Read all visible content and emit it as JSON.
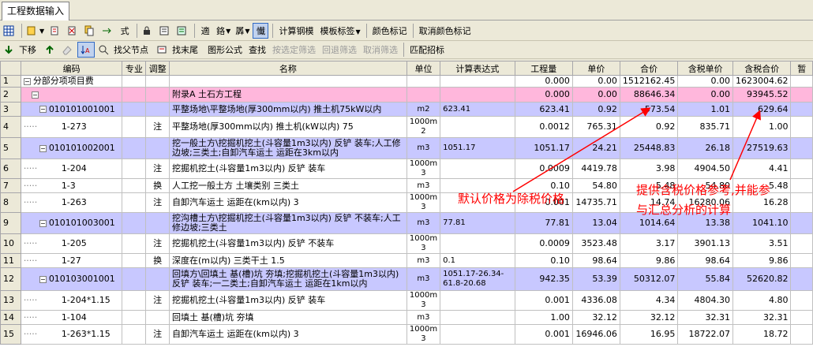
{
  "tab_title": "工程数据输入",
  "toolbar1": {
    "calc_steel": "计算钢模",
    "template_label": "模板标签",
    "color_mark": "颜色标记",
    "cancel_color_mark": "取消颜色标记",
    "icon_labels": {
      "i1": "",
      "i6": "式",
      "i7": "",
      "i12": "適",
      "i13": "鉻",
      "i14": "羼",
      "i15": "懴"
    }
  },
  "toolbar2": {
    "move_down": "下移",
    "find_parent": "找父节点",
    "find_tail": "找末尾",
    "shape_formula": "图形公式",
    "search": "查找",
    "select_filter": "按选定筛选",
    "restore_filter": "回退筛选",
    "cancel_filter": "取消筛选",
    "match_bid": "匹配招标"
  },
  "columns": [
    "编码",
    "专业",
    "调整",
    "名称",
    "单位",
    "计算表达式",
    "工程量",
    "单价",
    "合价",
    "含税单价",
    "含税合价",
    "暂"
  ],
  "rows": [
    {
      "n": "1",
      "code": "分部分项项目费",
      "pro": "",
      "adj": "",
      "name": "",
      "unit": "",
      "expr": "",
      "qty": "0.000",
      "price": "0.00",
      "total": "1512162.45",
      "tax_price": "0.00",
      "tax_total": "1623004.62",
      "style": ""
    },
    {
      "n": "2",
      "code": "",
      "pro": "",
      "adj": "",
      "name": "附录A 土石方工程",
      "unit": "",
      "expr": "",
      "qty": "0.000",
      "price": "0.00",
      "total": "88646.34",
      "tax_price": "0.00",
      "tax_total": "93945.52",
      "style": "pink"
    },
    {
      "n": "3",
      "code": "010101001001",
      "pro": "",
      "adj": "",
      "name": "平整场地\\平整场地(厚300mm以内) 推土机75kW以内",
      "unit": "m2",
      "expr": "623.41",
      "qty": "623.41",
      "price": "0.92",
      "total": "573.54",
      "tax_price": "1.01",
      "tax_total": "629.64",
      "style": "lav"
    },
    {
      "n": "4",
      "code": "1-273",
      "pro": "",
      "adj": "注",
      "name": "平整场地(厚300mm以内) 推土机(kW以内) 75",
      "unit": "1000m 2",
      "expr": "",
      "qty": "0.0012",
      "price": "765.31",
      "total": "0.92",
      "tax_price": "835.71",
      "tax_total": "1.00",
      "style": ""
    },
    {
      "n": "5",
      "code": "010101002001",
      "pro": "",
      "adj": "",
      "name": "挖一般土方\\挖掘机挖土(斗容量1m3以内) 反铲 装车;人工修边坡;三类土;自卸汽车运土 运距在3km以内",
      "unit": "m3",
      "expr": "1051.17",
      "qty": "1051.17",
      "price": "24.21",
      "total": "25448.83",
      "tax_price": "26.18",
      "tax_total": "27519.63",
      "style": "lav"
    },
    {
      "n": "6",
      "code": "1-204",
      "pro": "",
      "adj": "注",
      "name": "挖掘机挖土(斗容量1m3以内) 反铲 装车",
      "unit": "1000m 3",
      "expr": "",
      "qty": "0.0009",
      "price": "4419.78",
      "total": "3.98",
      "tax_price": "4904.50",
      "tax_total": "4.41",
      "style": ""
    },
    {
      "n": "7",
      "code": "1-3",
      "pro": "",
      "adj": "换",
      "name": "人工挖一般土方 土壤类别 三类土",
      "unit": "m3",
      "expr": "",
      "qty": "0.10",
      "price": "54.80",
      "total": "5.48",
      "tax_price": "54.80",
      "tax_total": "5.48",
      "style": ""
    },
    {
      "n": "8",
      "code": "1-263",
      "pro": "",
      "adj": "注",
      "name": "自卸汽车运土 运距在(km以内) 3",
      "unit": "1000m 3",
      "expr": "",
      "qty": "0.001",
      "price": "14735.71",
      "total": "14.74",
      "tax_price": "16280.06",
      "tax_total": "16.28",
      "style": ""
    },
    {
      "n": "9",
      "code": "010101003001",
      "pro": "",
      "adj": "",
      "name": "挖沟槽土方\\挖掘机挖土(斗容量1m3以内) 反铲 不装车;人工修边坡;三类土",
      "unit": "m3",
      "expr": "77.81",
      "qty": "77.81",
      "price": "13.04",
      "total": "1014.64",
      "tax_price": "13.38",
      "tax_total": "1041.10",
      "style": "lav"
    },
    {
      "n": "10",
      "code": "1-205",
      "pro": "",
      "adj": "注",
      "name": "挖掘机挖土(斗容量1m3以内) 反铲 不装车",
      "unit": "1000m 3",
      "expr": "",
      "qty": "0.0009",
      "price": "3523.48",
      "total": "3.17",
      "tax_price": "3901.13",
      "tax_total": "3.51",
      "style": ""
    },
    {
      "n": "11",
      "code": "1-27",
      "pro": "",
      "adj": "换",
      "name": "深度在(m以内) 三类干土 1.5",
      "unit": "m3",
      "expr": "0.1",
      "qty": "0.10",
      "price": "98.64",
      "total": "9.86",
      "tax_price": "98.64",
      "tax_total": "9.86",
      "style": ""
    },
    {
      "n": "12",
      "code": "010103001001",
      "pro": "",
      "adj": "",
      "name": "回填方\\回填土 基(槽)坑 夯填;挖掘机挖土(斗容量1m3以内) 反铲 装车;一二类土;自卸汽车运土 运距在1km以内",
      "unit": "m3",
      "expr": "1051.17-26.34-61.8-20.68",
      "qty": "942.35",
      "price": "53.39",
      "total": "50312.07",
      "tax_price": "55.84",
      "tax_total": "52620.82",
      "style": "lav"
    },
    {
      "n": "13",
      "code": "1-204*1.15",
      "pro": "",
      "adj": "注",
      "name": "挖掘机挖土(斗容量1m3以内) 反铲 装车",
      "unit": "1000m 3",
      "expr": "",
      "qty": "0.001",
      "price": "4336.08",
      "total": "4.34",
      "tax_price": "4804.30",
      "tax_total": "4.80",
      "style": ""
    },
    {
      "n": "14",
      "code": "1-104",
      "pro": "",
      "adj": "",
      "name": "回填土 基(槽)坑 夯填",
      "unit": "m3",
      "expr": "",
      "qty": "1.00",
      "price": "32.12",
      "total": "32.12",
      "tax_price": "32.31",
      "tax_total": "32.31",
      "style": ""
    },
    {
      "n": "15",
      "code": "1-263*1.15",
      "pro": "",
      "adj": "注",
      "name": "自卸汽车运土 运距在(km以内) 3",
      "unit": "1000m 3",
      "expr": "",
      "qty": "0.001",
      "price": "16946.06",
      "total": "16.95",
      "tax_price": "18722.07",
      "tax_total": "18.72",
      "style": ""
    }
  ],
  "annotations": {
    "left": "默认价格为除税价格",
    "right_line1": "提供含税价格参考,并能参",
    "right_line2": "与汇总分析的计算"
  },
  "colors": {
    "pink_row": "#ffb7dc",
    "lavender_row": "#c8c8ff",
    "annotation": "#ff0000"
  }
}
